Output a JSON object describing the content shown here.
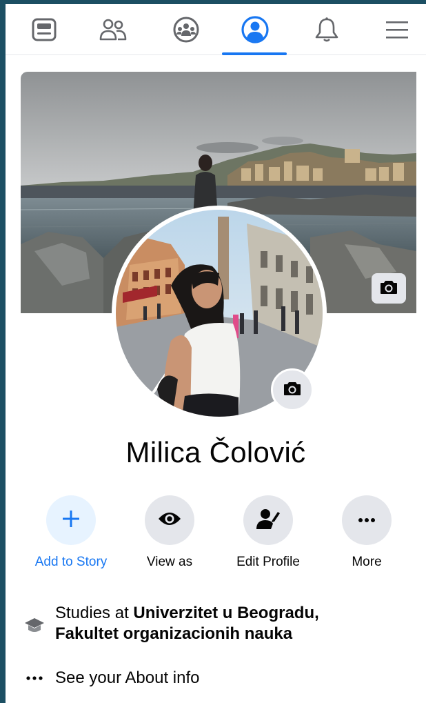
{
  "nav": {
    "tabs": [
      {
        "icon": "news-feed-icon"
      },
      {
        "icon": "friends-icon"
      },
      {
        "icon": "groups-icon"
      },
      {
        "icon": "profile-icon",
        "active": true
      },
      {
        "icon": "notifications-icon"
      },
      {
        "icon": "menu-icon"
      }
    ],
    "accent": "#1877f2"
  },
  "profile": {
    "name": "Milica Čolović"
  },
  "actions": [
    {
      "label": "Add to Story",
      "icon": "plus-icon",
      "color": "#1877f2"
    },
    {
      "label": "View as",
      "icon": "eye-icon"
    },
    {
      "label": "Edit Profile",
      "icon": "edit-profile-icon"
    },
    {
      "label": "More",
      "icon": "more-icon"
    }
  ],
  "info": {
    "studies_prefix": "Studies at ",
    "studies_school_line1": "Univerzitet u Beogradu,",
    "studies_school_line2": "Fakultet organizacionih nauka",
    "about_link": "See your About info"
  }
}
